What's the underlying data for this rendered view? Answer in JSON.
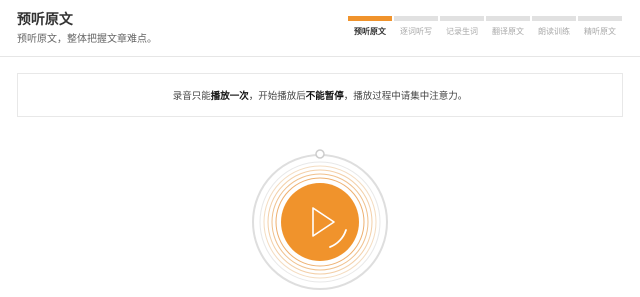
{
  "header": {
    "title": "预听原文",
    "subtitle": "预听原文，整体把握文章难点。"
  },
  "steps": [
    {
      "label": "预听原文",
      "active": true
    },
    {
      "label": "逐词听写",
      "active": false
    },
    {
      "label": "记录生词",
      "active": false
    },
    {
      "label": "翻译原文",
      "active": false
    },
    {
      "label": "朗读训练",
      "active": false
    },
    {
      "label": "精听原文",
      "active": false
    }
  ],
  "notice": {
    "part1": "录音只能",
    "bold1": "播放一次",
    "part2": "，开始播放后",
    "bold2": "不能暂停",
    "part3": "，播放过程中请集中注意力。"
  },
  "player": {
    "accent_color": "#f0932c",
    "play_icon": "play-icon"
  }
}
